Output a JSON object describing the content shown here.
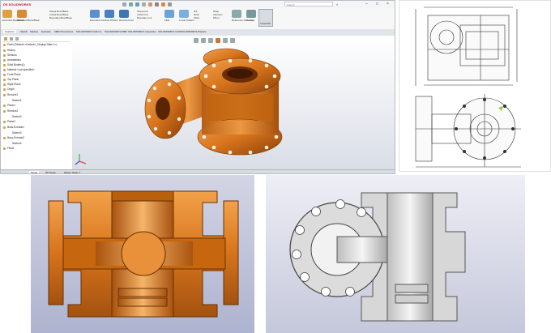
{
  "app": {
    "brand": "DS SOLIDWORKS",
    "search_hint": "Search"
  },
  "ribbon": {
    "items": [
      "Extruded Boss/Base",
      "Revolved Boss/Base",
      "Swept Boss/Base",
      "Lofted Boss/Base",
      "Boundary Boss/Base",
      "Extruded Cut",
      "Hole Wizard",
      "Revolved Cut",
      "Swept Cut",
      "Lofted Cut",
      "Boundary Cut",
      "Fillet",
      "Linear Pattern",
      "Rib",
      "Draft",
      "Shell",
      "Wrap",
      "Intersect",
      "Mirror",
      "Reference Geometry",
      "Curves",
      "Instant3D"
    ]
  },
  "tabs": [
    "Features",
    "Sketch",
    "Markup",
    "Evaluate",
    "MBD Dimensions",
    "SOLIDWORKS Add-Ins",
    "SOLIDWORKS MBD",
    "SOLIDWORKS Inspection",
    "SOLIDWORKS CAM",
    "SOLIDWORKS Plastics"
  ],
  "tree": {
    "items": [
      "Part4 (Default<<Default>_Display State 1>)",
      "History",
      "Sensors",
      "Annotations",
      "Solid Bodies(1)",
      "Material <not specified>",
      "Front Plane",
      "Top Plane",
      "Right Plane",
      "Origin",
      "Revolve1",
      "Sketch1",
      "Plane1",
      "Revolve2",
      "Sketch2",
      "Plane2",
      "Boss-Extrude1",
      "Sketch3",
      "Boss-Extrude2",
      "Sketch4",
      "Fillet1"
    ]
  },
  "bottom_tabs": [
    "Model",
    "3D Views",
    "Motion Study 1"
  ],
  "colors": {
    "part_orange": "#d7741c",
    "part_grey": "#d9d9d9",
    "accent_blue": "#2a63b4"
  }
}
